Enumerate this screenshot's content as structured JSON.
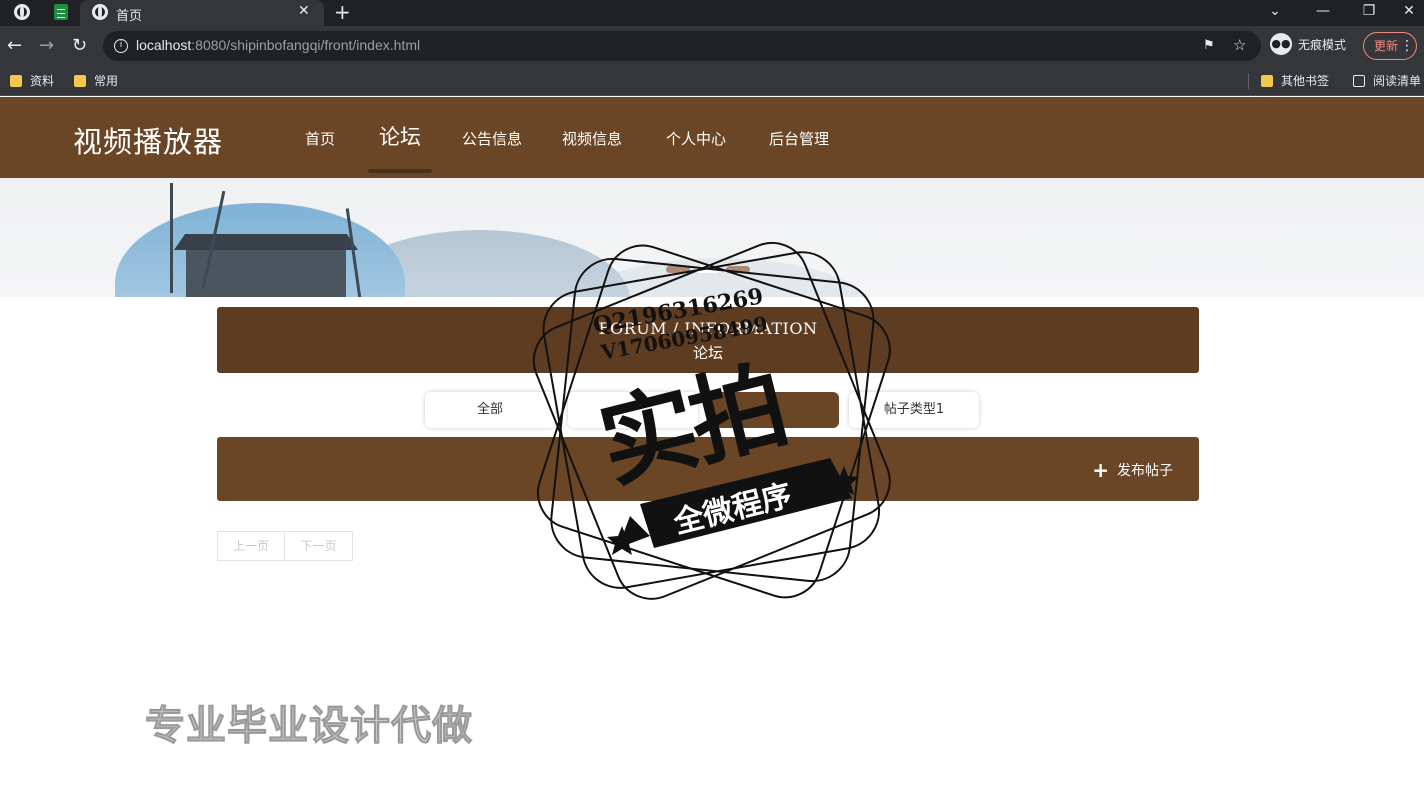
{
  "browser": {
    "active_tab_title": "首页",
    "url_host": "localhost",
    "url_rest": ":8080/shipinbofangqi/front/index.html",
    "incognito_label": "无痕模式",
    "update_label": "更新",
    "bookmarks": [
      "资料",
      "常用"
    ],
    "bookmarks_right": [
      "其他书签",
      "阅读清单"
    ]
  },
  "site": {
    "logo": "视频播放器",
    "nav": [
      "首页",
      "论坛",
      "公告信息",
      "视频信息",
      "个人中心",
      "后台管理"
    ],
    "active_nav": "论坛"
  },
  "forum": {
    "title_en": "FORUM / INFORMATION",
    "title_cn": "论坛",
    "categories": [
      "全部",
      "",
      "",
      "帖子类型1"
    ],
    "post_button": "发布帖子",
    "pager": {
      "prev": "上一页",
      "next": "下一页"
    }
  },
  "overlay": {
    "stamp_contact_1": "Q2196316269",
    "stamp_contact_2": "V17060958499",
    "stamp_main": "实拍",
    "stamp_ribbon": "全微程序",
    "bottom_watermark": "专业毕业设计代做"
  },
  "colors": {
    "header_brown": "#6b4626",
    "title_brown": "#5e3c22",
    "browser_dark": "#202124",
    "browser_toolbar": "#35363a"
  }
}
